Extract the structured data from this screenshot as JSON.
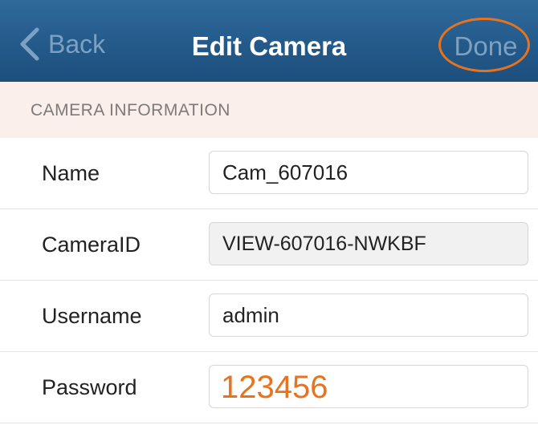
{
  "navbar": {
    "back_label": "Back",
    "title": "Edit Camera",
    "done_label": "Done",
    "highlight_color": "#e8731e",
    "bar_color": "#235a8a"
  },
  "section": {
    "title": "CAMERA INFORMATION"
  },
  "fields": {
    "name": {
      "label": "Name",
      "value": "Cam_607016"
    },
    "camera_id": {
      "label": "CameraID",
      "value": "VIEW-607016-NWKBF"
    },
    "username": {
      "label": "Username",
      "value": "admin"
    },
    "password": {
      "label": "Password",
      "value": "123456",
      "value_color": "#e8731e"
    }
  },
  "icons": {
    "back": "chevron-left-icon"
  }
}
